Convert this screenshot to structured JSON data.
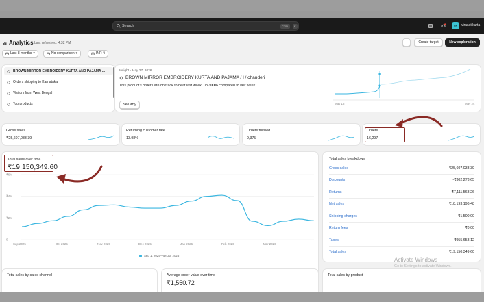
{
  "topbar": {
    "search_placeholder": "Search",
    "shortcut_key1": "CTRL",
    "shortcut_key2": "K",
    "store_initials": "VK",
    "store_name": "virasat kurta"
  },
  "header": {
    "title": "Analytics",
    "last_refreshed": "Last refreshed: 4:32 PM",
    "more_label": "···",
    "create_target": "Create target",
    "new_exploration": "New exploration"
  },
  "filters": {
    "date_range": "Last 8 months",
    "comparison": "No comparison",
    "currency": "INR ₹"
  },
  "suggestions": {
    "items": [
      {
        "label": "BROWN MIRROR EMBROIDERY KURTA AND PAJAMA ..."
      },
      {
        "label": "Orders shipping to Karnataka"
      },
      {
        "label": "Visitors from West Bengal"
      },
      {
        "label": "Top products"
      }
    ]
  },
  "insight": {
    "date_label": "Insight - May 27, 2026",
    "product_title": "BROWN MIRROR EMBROIDERY KURTA AND PAJAMA / l / chanderi",
    "text_prefix": "This product's orders are on track to beat last week, up ",
    "text_highlight": "300%",
    "text_suffix": " compared to last week.",
    "see_why": "See why",
    "x_start": "May 18",
    "x_end": "May 24"
  },
  "metrics": [
    {
      "title": "Gross sales",
      "value": "₹25,607,033.39"
    },
    {
      "title": "Returning customer rate",
      "value": "13.98%"
    },
    {
      "title": "Orders fulfilled",
      "value": "9,375"
    },
    {
      "title": "Orders",
      "value": "16,297"
    }
  ],
  "sales_over_time": {
    "title": "Total sales over time",
    "value": "₹19,150,349.60",
    "legend": "Sep 1, 2025–Apr 30, 2026"
  },
  "chart_data": {
    "type": "line",
    "title": "Total sales over time",
    "ylim": [
      0,
      6000000
    ],
    "y_ticks": [
      "₹6M",
      "₹4M",
      "₹2M",
      "0"
    ],
    "x_ticks": [
      "Sep 2025",
      "Oct 2025",
      "Nov 2025",
      "Dec 2025",
      "Jan 2026",
      "Feb 2026",
      "Mar 2026"
    ],
    "series": [
      {
        "name": "Sep 1, 2025–Apr 30, 2026",
        "x": [
          "Sep 2025",
          "early Oct",
          "Oct 2025",
          "early Nov",
          "Nov 2025",
          "mid Nov",
          "late Nov",
          "Dec 2025",
          "mid Dec",
          "late Dec",
          "Jan 2026",
          "mid Jan",
          "late Jan",
          "Feb 2026",
          "mid Feb",
          "late Feb",
          "Mar 2026",
          "mid Mar",
          "late Mar",
          "Apr 2026"
        ],
        "values": [
          1200000,
          1500000,
          1750000,
          2150000,
          2750000,
          3150000,
          3200000,
          3000000,
          2900000,
          2900000,
          3150000,
          3550000,
          4000000,
          4100000,
          3600000,
          1700000,
          1300000,
          1700000,
          1900000,
          1750000
        ]
      }
    ],
    "grid": true
  },
  "breakdown": {
    "title": "Total sales breakdown",
    "rows": [
      {
        "label": "Gross sales",
        "value": "₹25,607,033.39"
      },
      {
        "label": "Discounts",
        "value": "-₹302,273.65"
      },
      {
        "label": "Returns",
        "value": "-₹7,111,563.26"
      },
      {
        "label": "Net sales",
        "value": "₹18,193,196.48"
      },
      {
        "label": "Shipping charges",
        "value": "₹1,500.00"
      },
      {
        "label": "Return fees",
        "value": "₹0.00"
      },
      {
        "label": "Taxes",
        "value": "₹955,653.12"
      },
      {
        "label": "Total sales",
        "value": "₹19,150,349.60"
      }
    ]
  },
  "bottom_cards": {
    "by_channel": "Total sales by sales channel",
    "aov": "Average order value over time",
    "aov_value": "₹1,550.72",
    "by_product": "Total sales by product"
  },
  "watermark": {
    "line1": "Activate Windows",
    "line2": "Go to Settings to activate Windows."
  },
  "colors": {
    "accent_line": "#3ab6e0",
    "annotation": "#8a2a25",
    "link": "#2c6ecb"
  }
}
